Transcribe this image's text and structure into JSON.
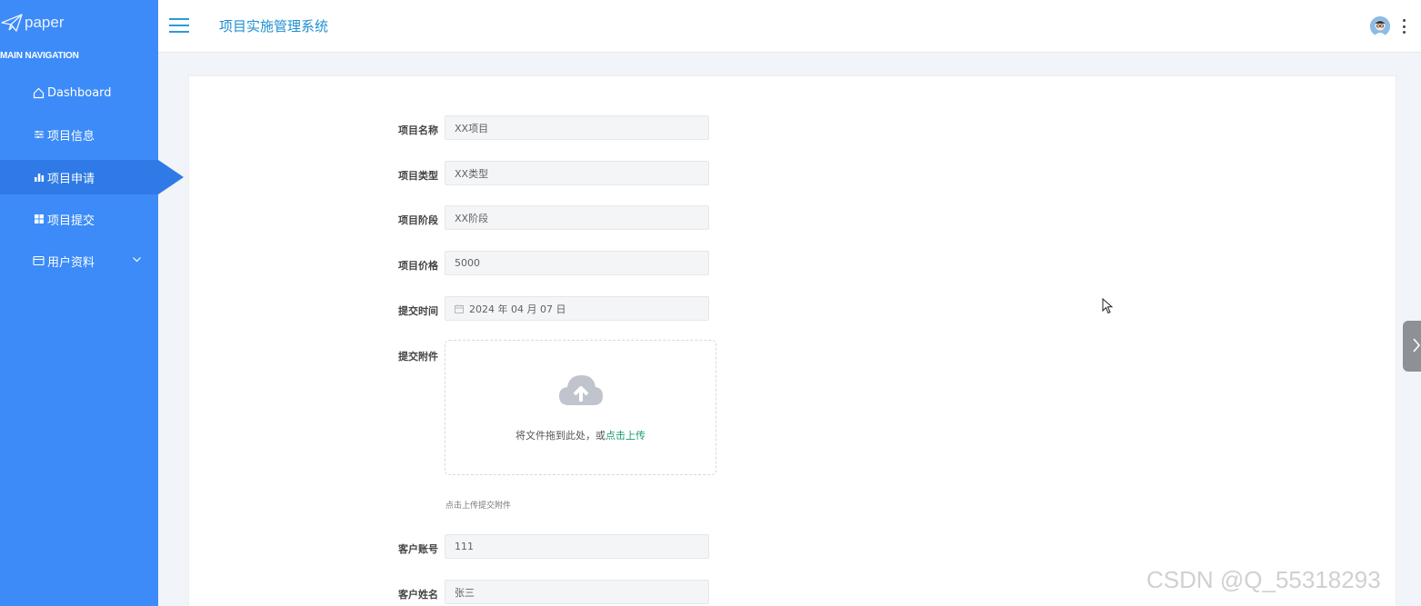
{
  "brand": {
    "logo_text": "paper"
  },
  "sidebar": {
    "section_header": "MAIN NAVIGATION",
    "items": [
      {
        "label": "Dashboard",
        "icon": "home-icon"
      },
      {
        "label": "项目信息",
        "icon": "sliders-icon"
      },
      {
        "label": "项目申请",
        "icon": "bar-chart-icon",
        "active": true
      },
      {
        "label": "项目提交",
        "icon": "grid-icon"
      },
      {
        "label": "用户资料",
        "icon": "id-card-icon",
        "expandable": true
      }
    ]
  },
  "header": {
    "title": "项目实施管理系统"
  },
  "form": {
    "fields": [
      {
        "label": "项目名称",
        "value": "XX项目"
      },
      {
        "label": "项目类型",
        "value": "XX类型"
      },
      {
        "label": "项目阶段",
        "value": "XX阶段"
      },
      {
        "label": "项目价格",
        "value": "5000"
      },
      {
        "label": "提交时间",
        "value": "2024 年 04 月 07 日"
      },
      {
        "label": "提交附件"
      },
      {
        "label": "客户账号",
        "value": "111"
      },
      {
        "label": "客户姓名",
        "value": "张三"
      }
    ],
    "upload": {
      "text": "将文件拖到此处，或",
      "link": "点击上传",
      "tip": "点击上传提交附件"
    }
  },
  "watermark": "CSDN @Q_55318293",
  "colors": {
    "sidebar": "#3c8bf8",
    "sidebar_active": "#2f7ae6",
    "title": "#1e8fd0",
    "link": "#1b9a6a"
  }
}
